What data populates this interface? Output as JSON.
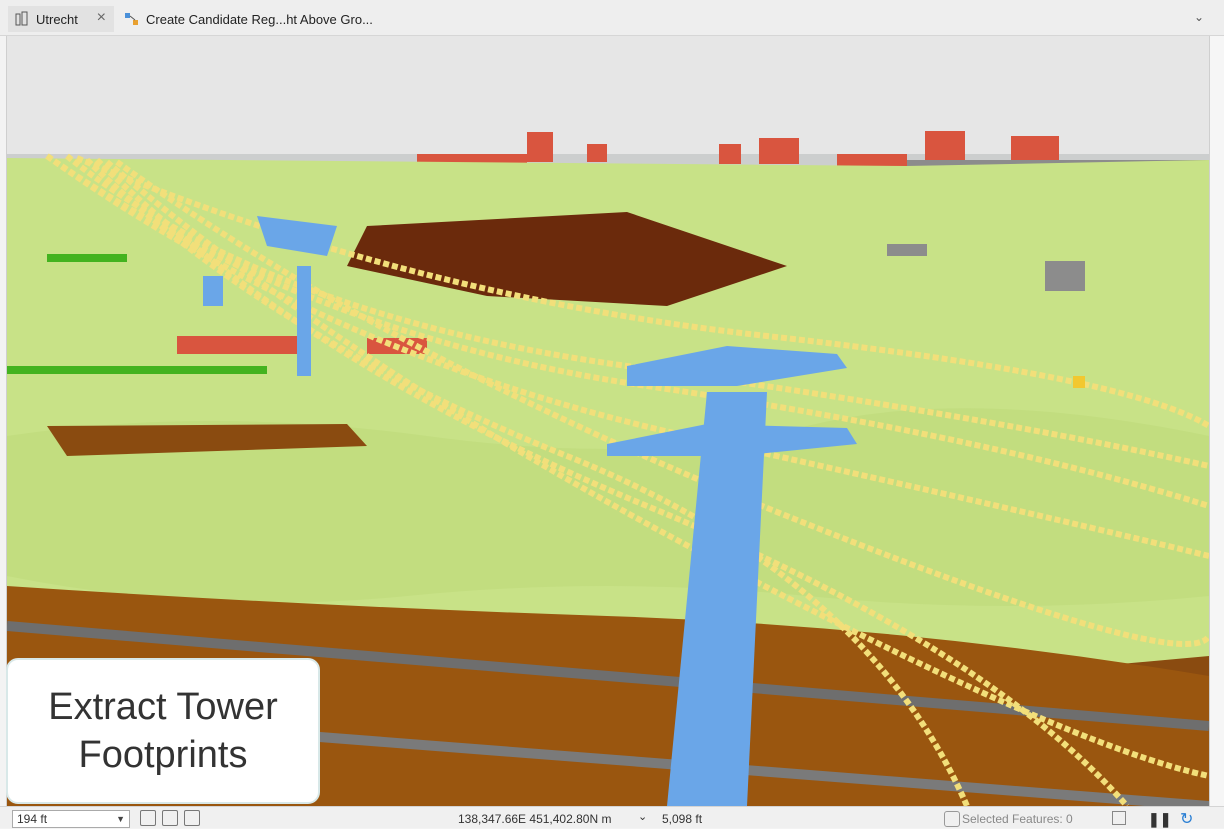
{
  "tabs": [
    {
      "label": "Utrecht",
      "icon": "map-building-icon",
      "active": true
    },
    {
      "label": "Create Candidate Reg...ht Above Gro...",
      "icon": "model-builder-icon",
      "active": false
    }
  ],
  "caption": {
    "line1": "Extract Tower",
    "line2": "Footprints"
  },
  "status": {
    "scale": "194 ft",
    "coordinates": "138,347.66E 451,402.80N m",
    "elevation": "5,098 ft",
    "selected_features": "Selected Features: 0"
  },
  "colors": {
    "sky": "#e6e6e6",
    "vegetation": "#c8e287",
    "ground": "#8a4b10",
    "building": "#d9553f",
    "tower": "#6aa6e8",
    "wire": "#f2df7a"
  }
}
